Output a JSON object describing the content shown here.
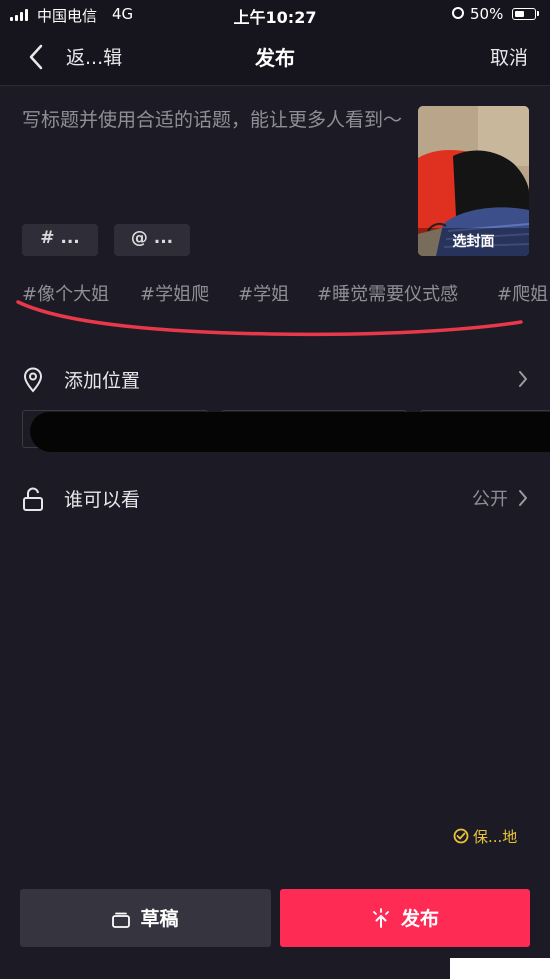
{
  "status_bar": {
    "carrier": "中国电信",
    "network": "4G",
    "time": "上午10:27",
    "battery": "50%",
    "battery_level": 0.5
  },
  "nav": {
    "back_label": "返...辑",
    "title": "发布",
    "cancel_label": "取消"
  },
  "caption": {
    "placeholder": "写标题并使用合适的话题，能让更多人看到～"
  },
  "cover": {
    "label": "选封面"
  },
  "chips": {
    "hashtag": "# ...",
    "mention": "@ ..."
  },
  "topics": [
    "#像个大姐",
    "#学姐爬",
    "#学姐",
    "#睡觉需要仪式感",
    "#爬姐"
  ],
  "location": {
    "label": "添加位置"
  },
  "privacy": {
    "label": "谁可以看",
    "value": "公开"
  },
  "save_local": {
    "label": "保...地"
  },
  "actions": {
    "draft_label": "草稿",
    "publish_label": "发布"
  },
  "colors": {
    "background": "#1c1b25",
    "publish": "#fe2c55",
    "draft": "#36353f",
    "annotation": "#e8394a",
    "save_local": "#e8c33a"
  },
  "icons": [
    "signal-icon",
    "back-chevron-icon",
    "location-pin-icon",
    "chevron-right-icon",
    "unlock-icon",
    "check-circle-icon",
    "draft-icon",
    "sparkle-publish-icon"
  ]
}
